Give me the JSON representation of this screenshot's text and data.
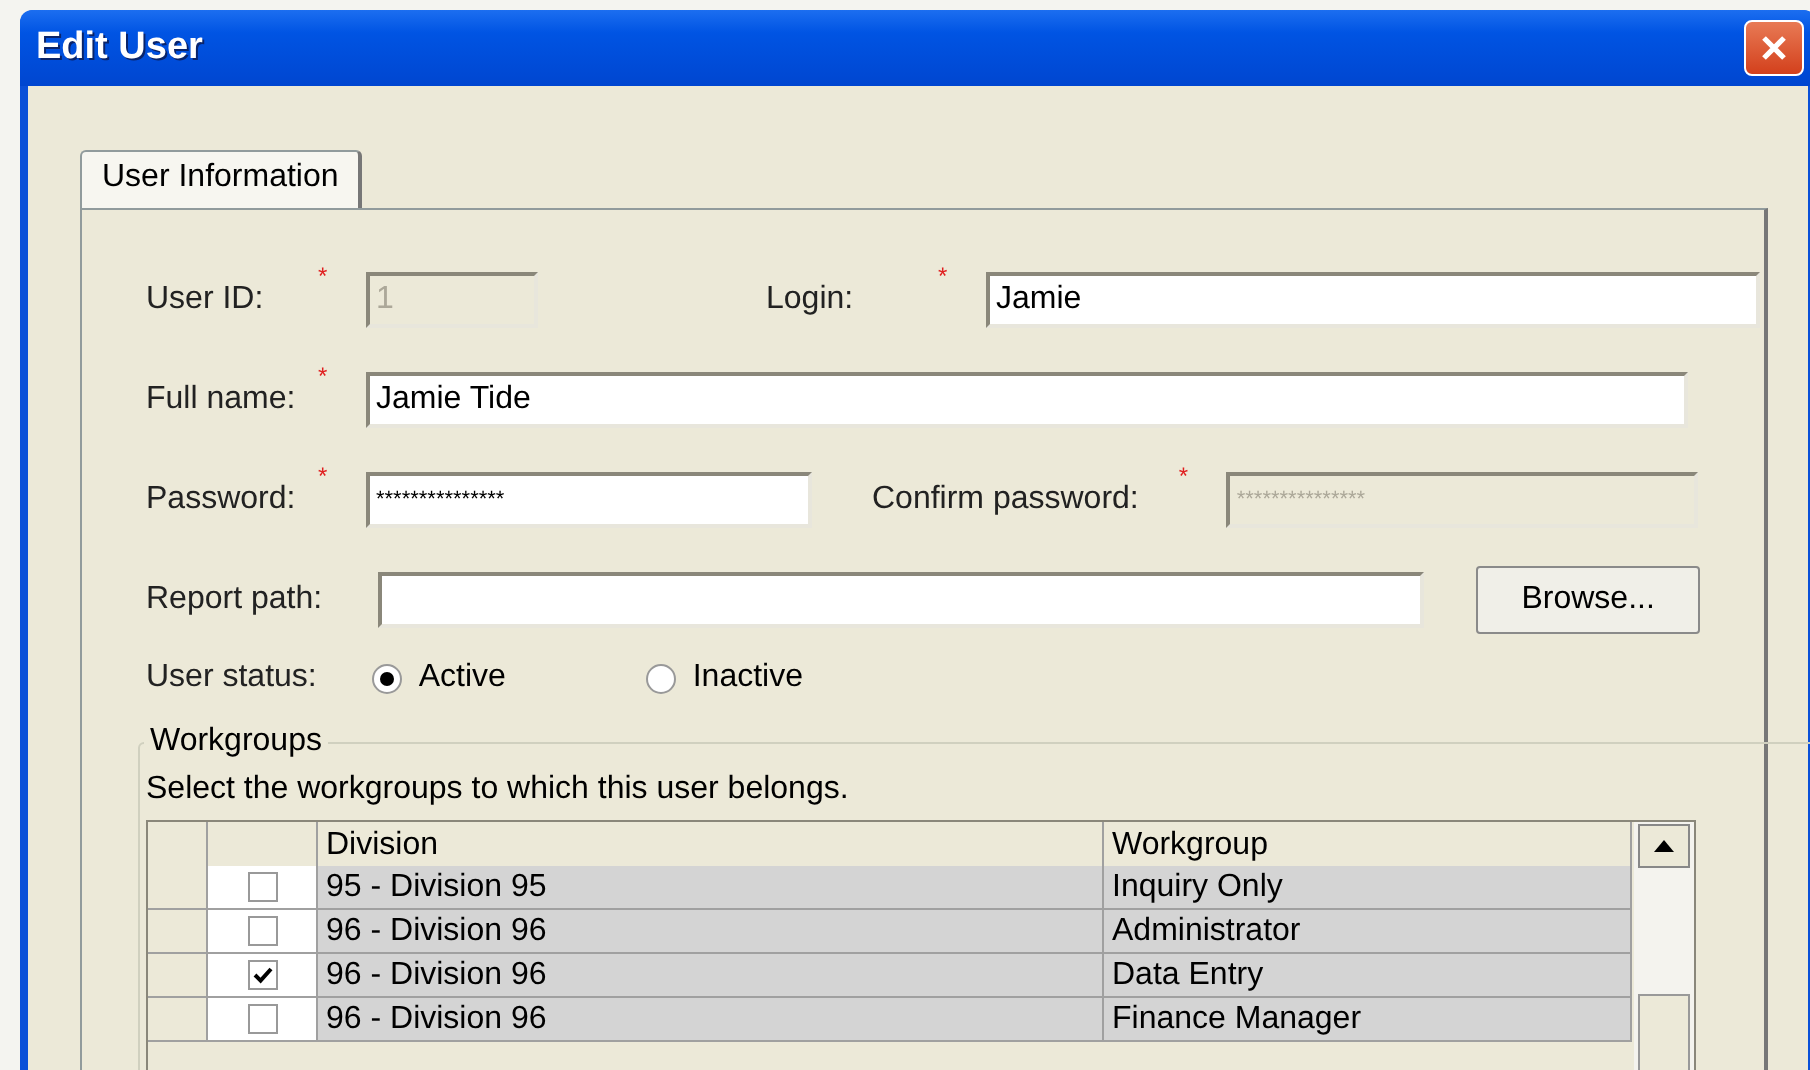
{
  "window": {
    "title": "Edit User"
  },
  "tabs": [
    {
      "label": "User Information",
      "selected": true
    }
  ],
  "user_id": {
    "label": "User ID:",
    "marker": "*",
    "value": "1",
    "disabled": true
  },
  "login": {
    "label": "Login:",
    "marker": "*",
    "value": "Jamie",
    "disabled": false
  },
  "full_name": {
    "label": "Full name:",
    "marker": "*",
    "value": "Jamie Tide",
    "disabled": false
  },
  "password": {
    "label": "Password:",
    "marker": "*",
    "value": "***************",
    "disabled": false
  },
  "confirm_password": {
    "label": "Confirm password:",
    "marker": "*",
    "value": "***************",
    "disabled": true
  },
  "report_path": {
    "label": "Report path:",
    "disabled": false
  },
  "browse_button": "Browse...",
  "user_status": {
    "label": "User status:",
    "options": [
      {
        "label": "Active",
        "selected": true
      },
      {
        "label": "Inactive",
        "selected": false
      }
    ]
  },
  "workgroups": {
    "title": "Workgroups",
    "hint": "Select the workgroups to which this user belongs.",
    "columns": [
      "Division",
      "Workgroup"
    ],
    "rows": [
      {
        "checked": false,
        "division": "95 - Division 95",
        "workgroup": "Inquiry Only"
      },
      {
        "checked": false,
        "division": "96 - Division 96",
        "workgroup": "Administrator"
      },
      {
        "checked": true,
        "division": "96 - Division 96",
        "workgroup": "Data Entry"
      },
      {
        "checked": false,
        "division": "96 - Division 96",
        "workgroup": "Finance Manager"
      }
    ]
  }
}
